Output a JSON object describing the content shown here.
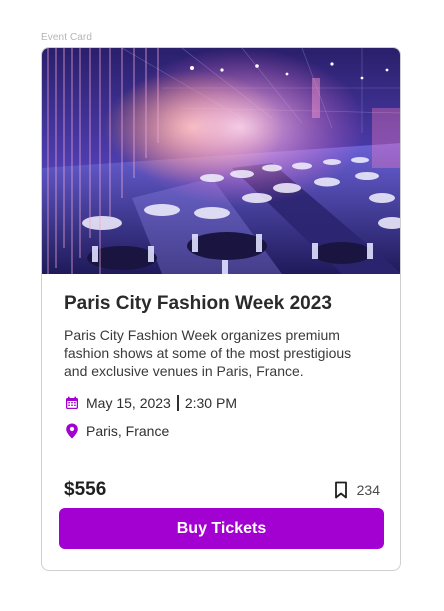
{
  "frame_label": "Event Card",
  "event": {
    "title": "Paris City Fashion Week 2023",
    "description": "Paris City Fashion Week organizes premium fashion shows at some of the most prestigious and exclusive venues in Paris, France.",
    "date": "May 15, 2023",
    "time": "2:30 PM",
    "location": "Paris, France",
    "price": "$556",
    "bookmark_count": "234",
    "cta_label": "Buy Tickets"
  },
  "icons": {
    "date": "calendar-icon",
    "location": "map-pin-icon",
    "bookmark": "bookmark-icon"
  },
  "colors": {
    "accent": "#a300d2",
    "icon_accent": "#a300d2",
    "card_border": "#cfcfcf",
    "text_primary": "#2a2a2a",
    "text_secondary": "#3a3a3a"
  }
}
